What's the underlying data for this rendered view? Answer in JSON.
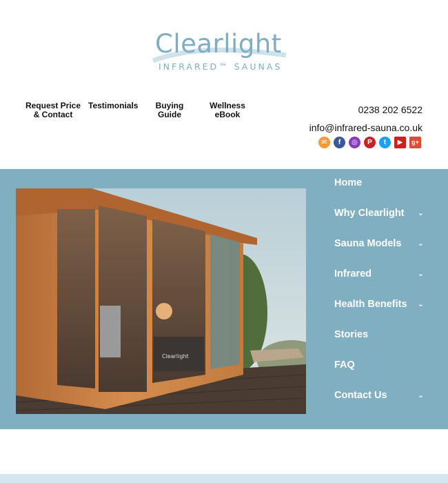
{
  "logo": {
    "wordmark": "Clearlight",
    "tagline": "INFRARED™ SAUNAS"
  },
  "top_nav": [
    {
      "label": "Request Price & Contact"
    },
    {
      "label": "Testimonials"
    },
    {
      "label": "Buying Guide"
    },
    {
      "label": "Wellness eBook"
    }
  ],
  "contact": {
    "phone": "0238 202 6522",
    "email": "info@infrared-sauna.co.uk"
  },
  "social_icons": [
    {
      "name": "email-icon",
      "color": "#f39a3a",
      "glyph": "✉"
    },
    {
      "name": "facebook-icon",
      "color": "#3b5998",
      "glyph": "f"
    },
    {
      "name": "instagram-icon",
      "color": "#8a3ab9",
      "glyph": "◎"
    },
    {
      "name": "pinterest-icon",
      "color": "#cb2027",
      "glyph": "P"
    },
    {
      "name": "twitter-icon",
      "color": "#1da1f2",
      "glyph": "t"
    },
    {
      "name": "youtube-icon",
      "color": "#cd201f",
      "glyph": "▶"
    },
    {
      "name": "google-plus-icon",
      "color": "#dd4b39",
      "glyph": "g+"
    }
  ],
  "side_nav": [
    {
      "label": "Home",
      "has_dropdown": false
    },
    {
      "label": "Why Clearlight",
      "has_dropdown": true
    },
    {
      "label": "Sauna Models",
      "has_dropdown": true
    },
    {
      "label": "Infrared",
      "has_dropdown": true
    },
    {
      "label": "Health Benefits",
      "has_dropdown": true
    },
    {
      "label": "Stories",
      "has_dropdown": false
    },
    {
      "label": "FAQ",
      "has_dropdown": false
    },
    {
      "label": "Contact Us",
      "has_dropdown": true
    }
  ],
  "hero_image": {
    "description_icon": "outdoor-sauna-image",
    "product_text": "Clearlight"
  },
  "colors": {
    "brand_blue": "#80afc2",
    "logo_blue": "#7faec4",
    "bottom_strip": "#d6e6ee"
  }
}
